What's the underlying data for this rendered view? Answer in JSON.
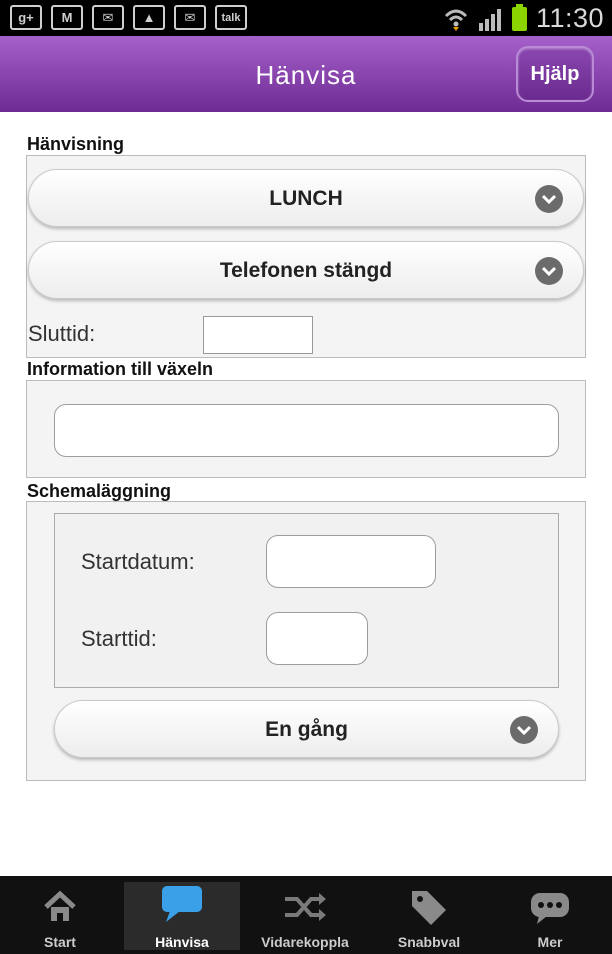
{
  "status_bar": {
    "time": "11:30",
    "notification_icons": [
      "g+",
      "gmail",
      "missed-mail",
      "image",
      "missed-mail",
      "talk"
    ]
  },
  "header": {
    "title": "Hänvisa",
    "help_label": "Hjälp"
  },
  "hanvisning": {
    "section_label": "Hänvisning",
    "reason_select": "LUNCH",
    "phone_select": "Telefonen stängd",
    "end_time_label": "Sluttid:",
    "end_time_value": ""
  },
  "information": {
    "section_label": "Information till växeln",
    "value": ""
  },
  "scheduling": {
    "section_label": "Schemaläggning",
    "start_date_label": "Startdatum:",
    "start_date_value": "",
    "start_time_label": "Starttid:",
    "start_time_value": "",
    "repeat_select": "En gång"
  },
  "tabs": [
    {
      "label": "Start",
      "icon": "home-icon",
      "active": false
    },
    {
      "label": "Hänvisa",
      "icon": "speech-bubble-icon",
      "active": true
    },
    {
      "label": "Vidarekoppla",
      "icon": "shuffle-icon",
      "active": false
    },
    {
      "label": "Snabbval",
      "icon": "tag-icon",
      "active": false
    },
    {
      "label": "Mer",
      "icon": "more-chat-icon",
      "active": false
    }
  ],
  "colors": {
    "header_top": "#a560c9",
    "header_bottom": "#6f2b94",
    "active_tab_icon": "#3aa0e8",
    "battery": "#8bd400"
  }
}
